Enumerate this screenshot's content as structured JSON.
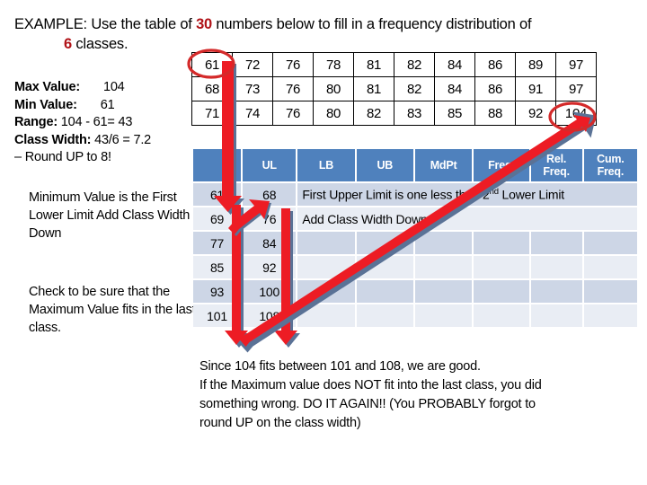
{
  "title": {
    "line1_pre": "EXAMPLE: Use the table of ",
    "line1_count": "30",
    "line1_post": " numbers below to fill in a frequency distribution of",
    "line2_count": "6",
    "line2_post": " classes."
  },
  "stats": {
    "max_label": "Max Value:",
    "max_value": "104",
    "min_label": "Min Value:",
    "min_value": "61",
    "range_label": "Range:",
    "range_value": "104 - 61= 43",
    "width_label": "Class Width:",
    "width_value": "43/6 = 7.2",
    "round_line": "– Round UP to 8!"
  },
  "notes": {
    "note1": "Minimum Value is the First Lower Limit Add Class Width Down",
    "note2": "Check to be sure that the Maximum Value fits in the last class."
  },
  "data_table": {
    "rows": [
      [
        "61",
        "72",
        "76",
        "78",
        "81",
        "82",
        "84",
        "86",
        "89",
        "97"
      ],
      [
        "68",
        "73",
        "76",
        "80",
        "81",
        "82",
        "84",
        "86",
        "91",
        "97"
      ],
      [
        "71",
        "74",
        "76",
        "80",
        "82",
        "83",
        "85",
        "88",
        "92",
        "104"
      ]
    ],
    "circled_first": "61",
    "circled_last": "104"
  },
  "freq_table": {
    "headers": [
      "",
      "UL",
      "LB",
      "UB",
      "MdPt",
      "Freq.",
      "Rel. Freq.",
      "Cum. Freq."
    ],
    "header_ll": "",
    "header_ul": "UL",
    "header_lb": "LB",
    "header_ub": "UB",
    "header_mdpt": "MdPt",
    "header_freq": "Freq.",
    "header_relfreq_l1": "Rel.",
    "header_relfreq_l2": "Freq.",
    "header_cumfreq_l1": "Cum.",
    "header_cumfreq_l2": "Freq.",
    "lower_limits": [
      "61",
      "69",
      "77",
      "85",
      "93",
      "101"
    ],
    "upper_limits": [
      "68",
      "76",
      "84",
      "92",
      "100",
      "108"
    ],
    "inline_note_1_pre": "First Upper Limit is one less than 2",
    "inline_note_1_sup": "nd",
    "inline_note_1_post": " Lower Limit",
    "inline_note_2": "Add Class Width Down"
  },
  "bottom": {
    "l1": "Since 104 fits between 101 and 108, we are good.",
    "l2": "If the Maximum value does NOT fit into the last class, you did",
    "l3": "something wrong. DO IT AGAIN!! (You PROBABLY forgot to",
    "l4": "round UP on the class width)"
  },
  "colors": {
    "header_blue": "#4F81BD",
    "row_dark": "#CDD6E6",
    "row_light": "#E9EDF4",
    "accent_red": "#B01217",
    "arrow_red": "#ED1C24",
    "arrow_outline": "#5A7296"
  }
}
